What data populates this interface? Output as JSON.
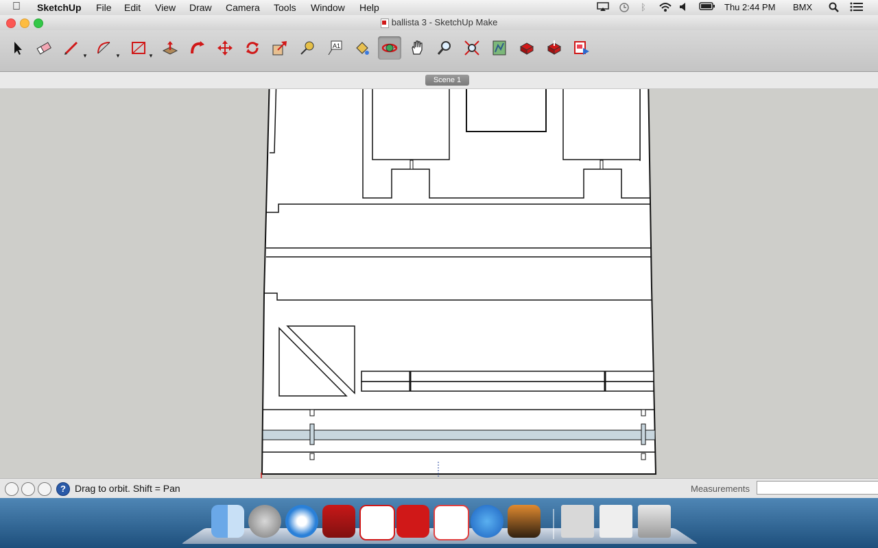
{
  "menubar": {
    "app": "SketchUp",
    "items": [
      "File",
      "Edit",
      "View",
      "Draw",
      "Camera",
      "Tools",
      "Window",
      "Help"
    ],
    "clock": "Thu 2:44 PM",
    "user": "BMX"
  },
  "window": {
    "title": "ballista 3 - SketchUp Make"
  },
  "toolbar": {
    "tools": [
      "select",
      "eraser",
      "pencil",
      "arc",
      "rectangle",
      "push-pull",
      "follow-me",
      "move",
      "rotate",
      "scale",
      "tape-measure",
      "text",
      "paint-bucket",
      "orbit",
      "pan",
      "zoom",
      "zoom-extents",
      "previous-view",
      "get-models",
      "share-model",
      "extension-warehouse",
      "send-to-layout"
    ],
    "active_tool": "orbit"
  },
  "scene": {
    "tab_label": "Scene 1"
  },
  "status": {
    "hint": "Drag to orbit.  Shift = Pan",
    "measurements_label": "Measurements",
    "measurements_value": ""
  },
  "dock": {
    "apps": [
      "Finder",
      "Launchpad",
      "Safari",
      "Photo Booth",
      "LayOut",
      "SketchUp",
      "Style Builder",
      "iTunes",
      "iPhoto",
      "Downloads stack",
      "Documents stack",
      "Trash"
    ]
  },
  "colors": {
    "viewport_bg": "#cececa",
    "accent_red": "#d01818",
    "highlight_strip": "#c8d6de"
  }
}
